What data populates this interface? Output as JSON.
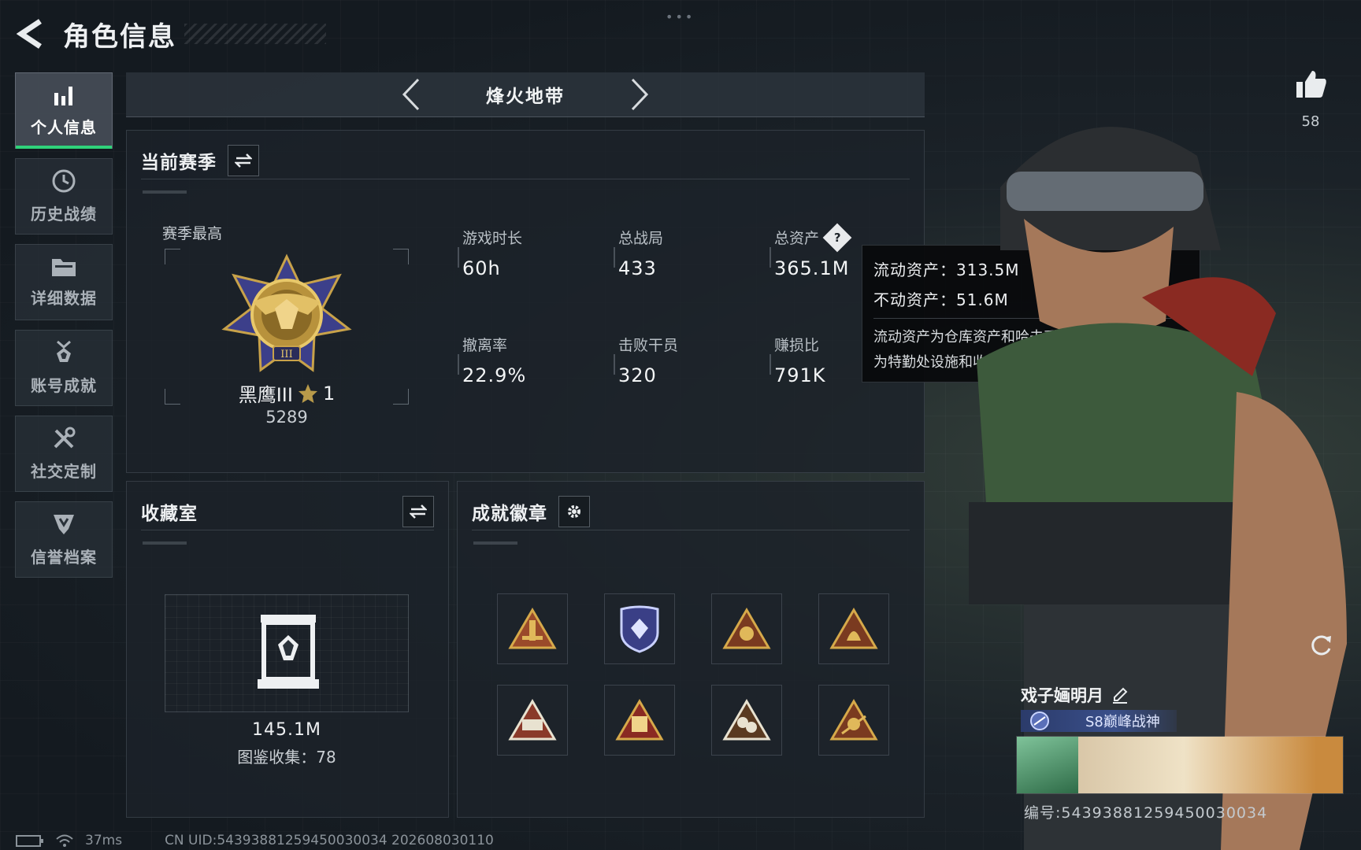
{
  "header": {
    "title": "角色信息"
  },
  "sidebar": {
    "items": [
      {
        "label": "个人信息",
        "icon": "bar-chart-icon",
        "active": true
      },
      {
        "label": "历史战绩",
        "icon": "history-clock-icon",
        "active": false
      },
      {
        "label": "详细数据",
        "icon": "folder-icon",
        "active": false
      },
      {
        "label": "账号成就",
        "icon": "medal-icon",
        "active": false
      },
      {
        "label": "社交定制",
        "icon": "tools-icon",
        "active": false
      },
      {
        "label": "信誉档案",
        "icon": "shield-credit-icon",
        "active": false
      }
    ]
  },
  "mode": {
    "title": "烽火地带"
  },
  "season": {
    "title": "当前赛季",
    "best_label": "赛季最高",
    "rank_name": "黑鹰III",
    "rank_stars": "1",
    "rank_score": "5289",
    "stats": [
      {
        "label": "游戏时长",
        "value": "60h"
      },
      {
        "label": "总战局",
        "value": "433"
      },
      {
        "label": "总资产",
        "value": "365.1M"
      },
      {
        "label": "撤离率",
        "value": "22.9%"
      },
      {
        "label": "击败干员",
        "value": "320"
      },
      {
        "label": "赚损比",
        "value": "791K"
      }
    ]
  },
  "tooltip": {
    "liquid": "流动资产：313.5M",
    "fixed": "不动资产：51.6M",
    "desc_line1": "流动资产为仓库资产和哈夫币，不动资产",
    "desc_line2": "为特勤处设施和收藏室设施"
  },
  "collection": {
    "title": "收藏室",
    "value": "145.1M",
    "count": "图鉴收集：78"
  },
  "achievements": {
    "title": "成就徽章",
    "badges": [
      "badge-1",
      "badge-2",
      "badge-3",
      "badge-4",
      "badge-5",
      "badge-6",
      "badge-7",
      "badge-8"
    ]
  },
  "profile": {
    "likes": "58",
    "name": "戏子婳明月",
    "title_banner": "S8巅峰战神",
    "uid_label": "编号:543938812594500300​34"
  },
  "footer": {
    "ping": "37ms",
    "uid_text": "CN UID:543938812594500300​34 202608030110"
  },
  "colors": {
    "accent": "#2fd27a",
    "gold": "#c8a24a",
    "panel": "#1c2229"
  }
}
